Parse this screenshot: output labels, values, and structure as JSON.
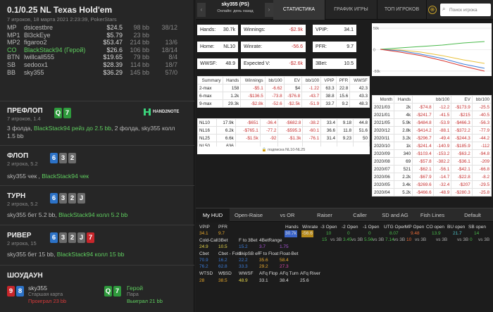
{
  "left": {
    "game_title": "0.1/0.25 NL Texas Hold'em",
    "game_sub": "7 игроков, 18 марта 2021 2:23:39, PokerStars",
    "players": [
      {
        "pos": "MP",
        "name": "dsicestbre",
        "win": "$24.5",
        "bb": "98 bb",
        "x": "38/12",
        "hero": false
      },
      {
        "pos": "MP1",
        "name": "Bl3ckEye",
        "win": "$5.79",
        "bb": "23 bb",
        "x": "",
        "hero": false
      },
      {
        "pos": "MP2",
        "name": "figaroo2",
        "win": "$53.47",
        "bb": "214 bb",
        "x": "13/6",
        "hero": false
      },
      {
        "pos": "CO",
        "name": "BlackStack94 (Герой)",
        "win": "$26.6",
        "bb": "106 bb",
        "x": "18/14",
        "hero": true
      },
      {
        "pos": "BTN",
        "name": "lwillcall555",
        "win": "$19.65",
        "bb": "79 bb",
        "x": "8/4",
        "hero": false
      },
      {
        "pos": "SB",
        "name": "sedoox1",
        "win": "$28.39",
        "bb": "114 bb",
        "x": "18/7",
        "hero": false
      },
      {
        "pos": "BB",
        "name": "sky355",
        "win": "$36.29",
        "bb": "145 bb",
        "x": "57/0",
        "hero": false
      }
    ],
    "preflop": {
      "name": "ПРЕФЛОП",
      "sub": "7 игроков, 1.4",
      "cards": [
        "Q",
        "7"
      ],
      "brand": "HAND2NOTE",
      "a1": "3 фолда, ",
      "a2": "BlackStack94 рейз до 2.5 bb",
      "a3": ", 2 фолда, sky355 колл",
      "a4": "1.5 bb"
    },
    "flop": {
      "name": "ФЛОП",
      "sub": "2 игрока, 5.2",
      "cards": [
        "6",
        "3",
        "2"
      ],
      "a1": "sky355 чек , ",
      "a2": "BlackStack94 чек"
    },
    "turn": {
      "name": "ТУРН",
      "sub": "2 игрока, 5.2",
      "cards": [
        "6",
        "3",
        "2",
        "J"
      ],
      "a1": "sky355 бет 5.2 bb, ",
      "a2": "BlackStack94 колл 5.2 bb"
    },
    "river": {
      "name": "РИВЕР",
      "sub": "2 игрока, 15",
      "cards": [
        "6",
        "3",
        "2",
        "J",
        "7"
      ],
      "a1": "sky355 бет 15 bb, ",
      "a2": "BlackStack94 колл 15 bb"
    },
    "showdown": {
      "name": "ШОУДАУН",
      "p1": "sky355",
      "p1_hand": "Старшая карта",
      "p1_res": "Проиграл 23 bb",
      "p1_cards": [
        "9",
        "8"
      ],
      "p2": "Герой",
      "p2_hand": "Пара",
      "p2_res": "Выиграл 21 bb",
      "p2_cards": [
        "Q",
        "7"
      ]
    }
  },
  "top": {
    "player": "sky355 (PS)",
    "status": "Онлайн: день назад",
    "tabs": [
      "СТАТИСТИКА",
      "ГРАФИК ИГРЫ",
      "ТОП ИГРОКОВ"
    ],
    "search_placeholder": "Поиск игрока",
    "lock": "⊕"
  },
  "summary": {
    "hands": {
      "label": "Hands:",
      "value": "30.7k"
    },
    "winnings": {
      "label": "Winnings:",
      "value": "-$2.9k"
    },
    "vpip": {
      "label": "VPIP:",
      "value": "34.1"
    },
    "home": {
      "label": "Home:",
      "value": "NL10"
    },
    "winrate": {
      "label": "Winrate:",
      "value": "-56.6"
    },
    "pfr": {
      "label": "PFR:",
      "value": "9.7"
    },
    "wwsf": {
      "label": "WWSF:",
      "value": "48.9"
    },
    "expected": {
      "label": "Expected V:",
      "value": "-$2.6k"
    },
    "bet3": {
      "label": "3Bet:",
      "value": "10.5"
    }
  },
  "graph": {
    "y_ticks": [
      "50k",
      "0",
      "-50k"
    ],
    "y_values": [
      50,
      0,
      -50
    ],
    "y_range": [
      -55,
      55
    ]
  },
  "tmax": {
    "headers": [
      "Summary",
      "Hands",
      "Winnings",
      "bb/100",
      "EV",
      "bb/100",
      "VPIP",
      "PFR",
      "WWSF"
    ],
    "rows": [
      [
        "2-max",
        "158",
        "-$5.1",
        "-6.62",
        "$4",
        "-1.22",
        "63.3",
        "22.8",
        "42.3"
      ],
      [
        "6-max",
        "1.2k",
        "-$136.5",
        "-73.8",
        "-$76.8",
        "-43.7",
        "38.8",
        "15.6",
        "43.3"
      ],
      [
        "9-max",
        "29.3k",
        "-$2.8k",
        "-52.6",
        "-$2.5k",
        "-51.9",
        "33.7",
        "9.2",
        "48.3"
      ]
    ]
  },
  "limits": {
    "rows": [
      [
        "NL10",
        "17.9k",
        "-$651",
        "-36.4",
        "-$682.8",
        "-38.2",
        "33.4",
        "9.18",
        "44.8"
      ],
      [
        "NL16",
        "6.2k",
        "-$765.1",
        "-77.2",
        "-$595.3",
        "-60.1",
        "36.6",
        "11.8",
        "51.6"
      ],
      [
        "NL25",
        "6.6k",
        "-$1.5k",
        "-92",
        "-$1.3k",
        "-76.1",
        "31.4",
        "9.23",
        "50"
      ],
      [
        "NL50",
        "636",
        "",
        "",
        "",
        "",
        "",
        "",
        ""
      ]
    ],
    "footer": "подписка NL10-NL25"
  },
  "monthly": {
    "headers": [
      "Month",
      "Hands",
      "bb/100",
      "EV",
      "bb/100"
    ],
    "rows": [
      [
        "2021/03",
        "2k",
        "-$74.8",
        "-12.2",
        "-$173.9",
        "-25.5"
      ],
      [
        "2021/01",
        "4k",
        "-$241.7",
        "-41.5",
        "-$215",
        "-40.5"
      ],
      [
        "2021/05",
        "5.9k",
        "-$484.8",
        "-53.9",
        "-$466.3",
        "-56.3"
      ],
      [
        "2020/12",
        "2.8k",
        "-$414.2",
        "-88.1",
        "-$372.2",
        "-77.9"
      ],
      [
        "2020/11",
        "3.2k",
        "-$296.7",
        "-49.4",
        "-$244.3",
        "-44.2"
      ],
      [
        "2020/10",
        "1k",
        "-$241.4",
        "-140.9",
        "-$185.9",
        "-112"
      ],
      [
        "2020/09",
        "340",
        "-$103.4",
        "-153.2",
        "-$63.2",
        "-94.8"
      ],
      [
        "2020/08",
        "69",
        "-$57.8",
        "-382.2",
        "-$36.1",
        "-209"
      ],
      [
        "2020/07",
        "521",
        "-$62.1",
        "-56.1",
        "-$42.1",
        "-66.8"
      ],
      [
        "2020/06",
        "2.2k",
        "-$67.9",
        "-14.7",
        "-$22.8",
        "-8.2"
      ],
      [
        "2020/05",
        "3.4k",
        "-$269.6",
        "-32.4",
        "-$207",
        "-29.5"
      ],
      [
        "2020/04",
        "5.2k",
        "-$466.6",
        "-48.9",
        "-$280.3",
        "-25.8"
      ]
    ]
  },
  "hud": {
    "tabs": [
      "My HUD",
      "Open-Raise",
      "vs OR",
      "Raiser",
      "Caller",
      "SD and AG",
      "Fish Lines",
      "Default"
    ],
    "left_labels": [
      [
        "VPIP",
        "PFR"
      ],
      [
        "Cold-Call",
        "3Bet",
        "F to 3Bet",
        "4BetRange"
      ],
      [
        "Cbet",
        "Cbet - Fold",
        "SkipSB eF",
        "F to Float",
        "Float-Bet"
      ],
      [
        "WTSD",
        "W$SD",
        "WWSF",
        "AFq Flop",
        "AFq Turn",
        "AFq River"
      ]
    ],
    "left_values": [
      [
        "34.1",
        "9.7"
      ],
      [
        "24.9",
        "10.5",
        "15.2",
        "3.7",
        "1.75"
      ],
      [
        "70.9",
        "16.2",
        "22.2",
        "35.6",
        "58.4"
      ],
      [
        "76.2",
        "62.8",
        "33.3",
        "29.2",
        "27.3"
      ],
      [
        "28",
        "38.5",
        "48.9",
        "33.1",
        "38.4",
        "25.6"
      ]
    ],
    "mid": {
      "labels": [
        "Hands",
        "Winrate"
      ],
      "values": [
        "30.7k",
        "-56.6"
      ]
    },
    "right_labels": [
      "-3 Open",
      "-2 Open",
      "-1 Open",
      "UTG Open",
      "MP Open",
      "CO open",
      "BU open",
      "SB open"
    ],
    "right_vals1": [
      "10",
      "0",
      "0",
      "8.07",
      "9.48",
      "13.9",
      "21.7",
      "14"
    ],
    "right_vals2": [
      "15",
      "3.45",
      "5.56",
      "7.14",
      "10",
      "",
      "",
      "0"
    ],
    "right_sub": [
      "vs 3B",
      "vs 3B",
      "vs 3B",
      "vs 3B",
      "vs 3B",
      "vs 3B",
      "vs 3B",
      "vs 3B"
    ]
  }
}
